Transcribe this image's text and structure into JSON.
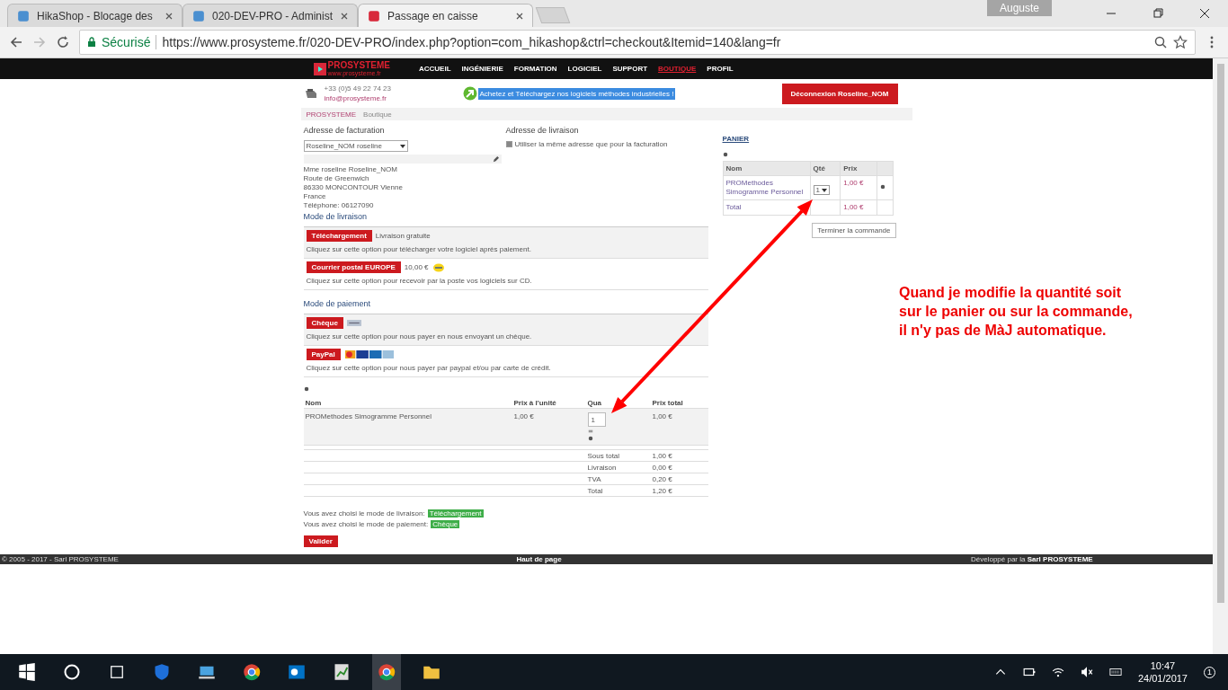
{
  "browser": {
    "tabs": [
      {
        "title": "HikaShop - Blocage des",
        "selected": false
      },
      {
        "title": "020-DEV-PRO - Administ",
        "selected": false
      },
      {
        "title": "Passage en caisse",
        "selected": true
      }
    ],
    "user": "Auguste",
    "secure_label": "Sécurisé",
    "url": "https://www.prosysteme.fr/020-DEV-PRO/index.php?option=com_hikashop&ctrl=checkout&Itemid=140&lang=fr"
  },
  "site": {
    "logo": "PROSYSTEME",
    "logo_sub": "www.prosysteme.fr",
    "nav": [
      {
        "label": "ACCUEIL",
        "selected": false
      },
      {
        "label": "INGÉNIERIE",
        "selected": false
      },
      {
        "label": "FORMATION",
        "selected": false
      },
      {
        "label": "LOGICIEL",
        "selected": false
      },
      {
        "label": "SUPPORT",
        "selected": false
      },
      {
        "label": "BOUTIQUE",
        "selected": true
      },
      {
        "label": "PROFIL",
        "selected": false
      }
    ],
    "phone": "+33 (0)5 49 22 74 23",
    "email": "info@prosysteme.fr",
    "banner": "Achetez et Téléchargez nos logiciels méthodes industrielles !",
    "logout": "Déconnexion Roseline_NOM",
    "breadcrumb": [
      "PROSYSTEME",
      "Boutique"
    ]
  },
  "billing": {
    "title": "Adresse de facturation",
    "select": "Roseline_NOM roseline",
    "lines": [
      "Mme roseline Roseline_NOM",
      "Route de Greenwich",
      "86330 MONCONTOUR Vienne",
      "France",
      "Téléphone: 06127090"
    ]
  },
  "shipping": {
    "title": "Adresse de livraison",
    "same_label": "Utiliser la même adresse que pour la facturation",
    "checked": true
  },
  "delivery": {
    "title": "Mode de livraison",
    "options": [
      {
        "label": "Téléchargement",
        "price": "Livraison gratuite",
        "desc": "Cliquez sur cette option pour télécharger votre logiciel après paiement.",
        "selected": true
      },
      {
        "label": "Courrier postal EUROPE",
        "price": "10,00 €",
        "desc": "Cliquez sur cette option pour recevoir par la poste vos logiciels sur CD.",
        "selected": false
      }
    ]
  },
  "payment": {
    "title": "Mode de paiement",
    "options": [
      {
        "label": "Chèque",
        "desc": "Cliquez sur cette option pour nous payer en nous envoyant un chèque.",
        "selected": true,
        "kind": "cheque"
      },
      {
        "label": "PayPal",
        "desc": "Cliquez sur cette option pour nous payer par paypal et/ou par carte de crédit.",
        "selected": false,
        "kind": "cards"
      }
    ]
  },
  "order": {
    "columns": [
      "Nom",
      "Prix à l'unité",
      "Qua",
      "Prix total"
    ],
    "row": {
      "name": "PROMethodes Simogramme Personnel",
      "unit": "1,00 €",
      "qty": "1",
      "total": "1,00 €"
    },
    "totals": [
      {
        "label": "Sous total",
        "value": "1,00 €"
      },
      {
        "label": "Livraison",
        "value": "0,00 €"
      },
      {
        "label": "TVA",
        "value": "0,20 €"
      },
      {
        "label": "Total",
        "value": "1,20 €"
      }
    ]
  },
  "summary": [
    {
      "text": "Vous avez choisi le mode de livraison:",
      "tag": "Téléchargement"
    },
    {
      "text": "Vous avez choisi le mode de paiement:",
      "tag": "Chèque"
    }
  ],
  "validate": "Valider",
  "cart": {
    "title": "PANIER",
    "columns": [
      "Nom",
      "Qté",
      "Prix"
    ],
    "item": "PROMethodes Simogramme Personnel",
    "qty": "1",
    "price": "1,00 €",
    "total_label": "Total",
    "total": "1,00 €",
    "button": "Terminer la commande"
  },
  "annotation": [
    "Quand je modifie la quantité soit",
    "sur le panier ou sur la commande,",
    "il n'y pas de MàJ automatique."
  ],
  "footer": {
    "left": "© 2005 - 2017 - Sarl PROSYSTEME",
    "center": "Haut de page",
    "right_prefix": "Développé par la",
    "right_name": "Sarl PROSYSTEME"
  },
  "taskbar": {
    "time": "10:47",
    "date": "24/01/2017",
    "notifications": "1"
  }
}
